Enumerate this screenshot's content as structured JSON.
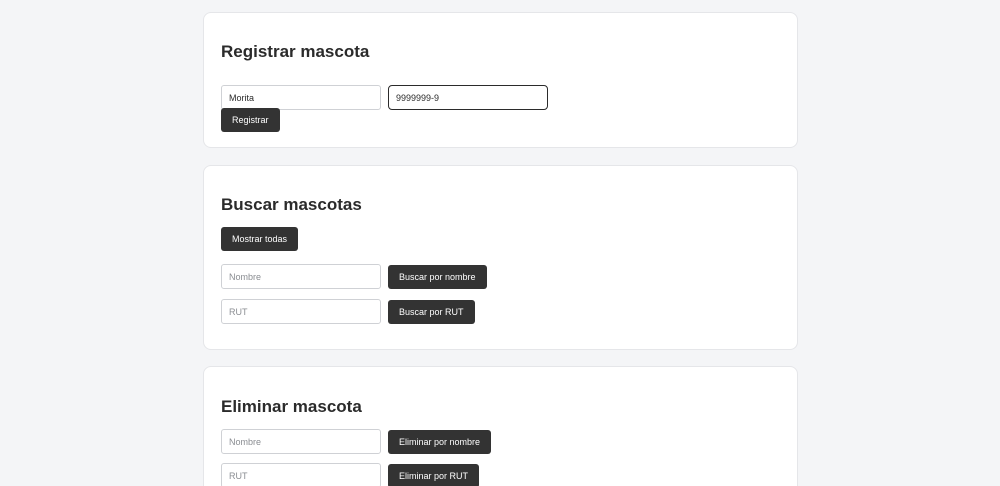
{
  "register": {
    "title": "Registrar mascota",
    "name_value": "Morita",
    "rut_value": "9999999-9",
    "submit_label": "Registrar"
  },
  "search": {
    "title": "Buscar mascotas",
    "show_all_label": "Mostrar todas",
    "name_placeholder": "Nombre",
    "name_button_label": "Buscar por nombre",
    "rut_placeholder": "RUT",
    "rut_button_label": "Buscar por RUT"
  },
  "delete": {
    "title": "Eliminar mascota",
    "name_placeholder": "Nombre",
    "name_button_label": "Eliminar por nombre",
    "rut_placeholder": "RUT",
    "rut_button_label": "Eliminar por RUT"
  }
}
